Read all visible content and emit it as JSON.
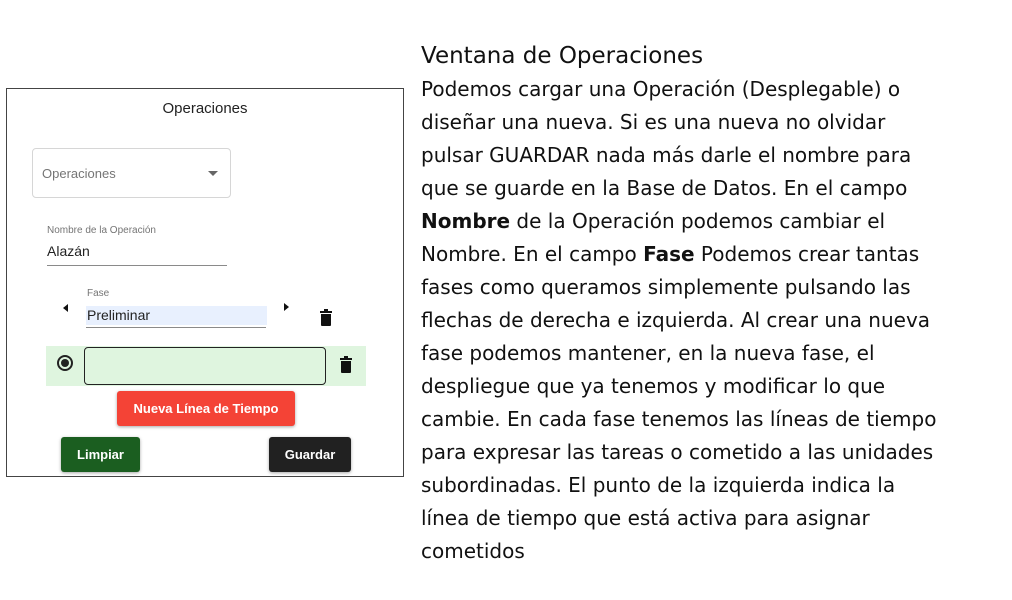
{
  "panel": {
    "title": "Operaciones",
    "select": {
      "placeholder": "Operaciones"
    },
    "name_field": {
      "label": "Nombre de la Operación",
      "value": "Alazán"
    },
    "fase_field": {
      "label": "Fase",
      "value": "Preliminar"
    },
    "buttons": {
      "new_timeline": "Nueva Línea de Tiempo",
      "clear": "Limpiar",
      "save": "Guardar"
    },
    "colors": {
      "new_timeline": "#f44336",
      "clear": "#1b5e20",
      "save": "#212121",
      "timeline_bg": "#dff5df",
      "fase_bg": "#e8f0fe"
    }
  },
  "doc": {
    "title": "Ventana de Operaciones",
    "lines": [
      [
        "Podemos cargar una Operación (Desplegable) o"
      ],
      [
        "diseñar una nueva. Si es una nueva no olvidar"
      ],
      [
        "pulsar GUARDAR nada más darle el nombre para"
      ],
      [
        "que se guarde en la Base de Datos. En el campo"
      ],
      [
        "Nombre",
        " de la Operación podemos cambiar el"
      ],
      [
        "Nombre. En el campo ",
        "Fase",
        " Podemos crear tantas"
      ],
      [
        "fases como queramos simplemente pulsando las"
      ],
      [
        "flechas de derecha e izquierda. Al crear una nueva"
      ],
      [
        "fase podemos mantener, en la nueva fase, el"
      ],
      [
        "despliegue que ya tenemos y modificar lo que"
      ],
      [
        "cambie. En cada fase tenemos las líneas de tiempo"
      ],
      [
        "para expresar las tareas o cometido a las unidades"
      ],
      [
        "subordinadas. El punto de la izquierda indica la"
      ],
      [
        "línea de tiempo que está activa para asignar"
      ],
      [
        "cometidos"
      ]
    ]
  }
}
